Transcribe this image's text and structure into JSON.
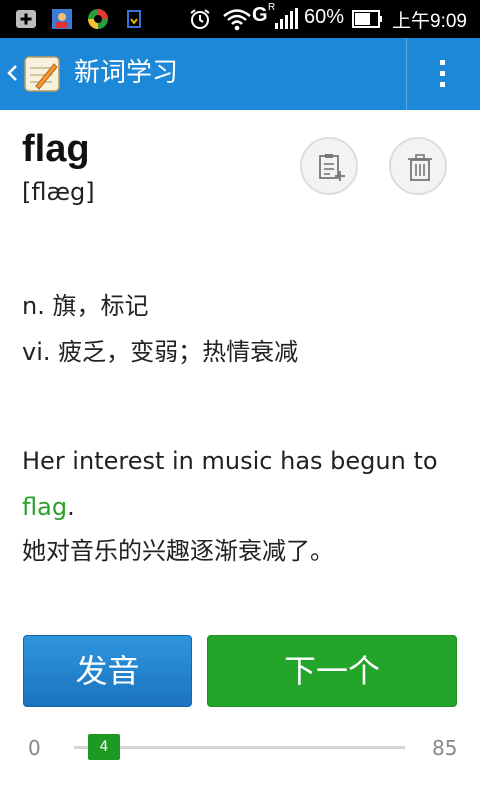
{
  "status_bar": {
    "network_label": "G",
    "roaming_label": "R",
    "battery": "60%",
    "time": "上午9:09"
  },
  "app_bar": {
    "title": "新词学习",
    "accent_color": "#1e88d8"
  },
  "word": {
    "headword": "flag",
    "phonetic": "[flæg]"
  },
  "definitions": [
    "n. 旗，标记",
    "vi. 疲乏，变弱；热情衰减"
  ],
  "example": {
    "english_before": "Her interest in music has begun to",
    "english_highlight": "flag",
    "english_after": ".",
    "chinese": "她对音乐的兴趣逐渐衰减了。",
    "highlight_color": "#2aa22a"
  },
  "buttons": {
    "pronounce": "发音",
    "next": "下一个"
  },
  "progress": {
    "min": "0",
    "current": "4",
    "max": "85",
    "fraction": 0.047
  },
  "icons": {
    "add_to_list": "notebook-add-icon",
    "delete": "trash-icon",
    "menu": "more-vertical-icon",
    "back": "chevron-left-icon",
    "app_logo": "words-notebook-icon"
  }
}
